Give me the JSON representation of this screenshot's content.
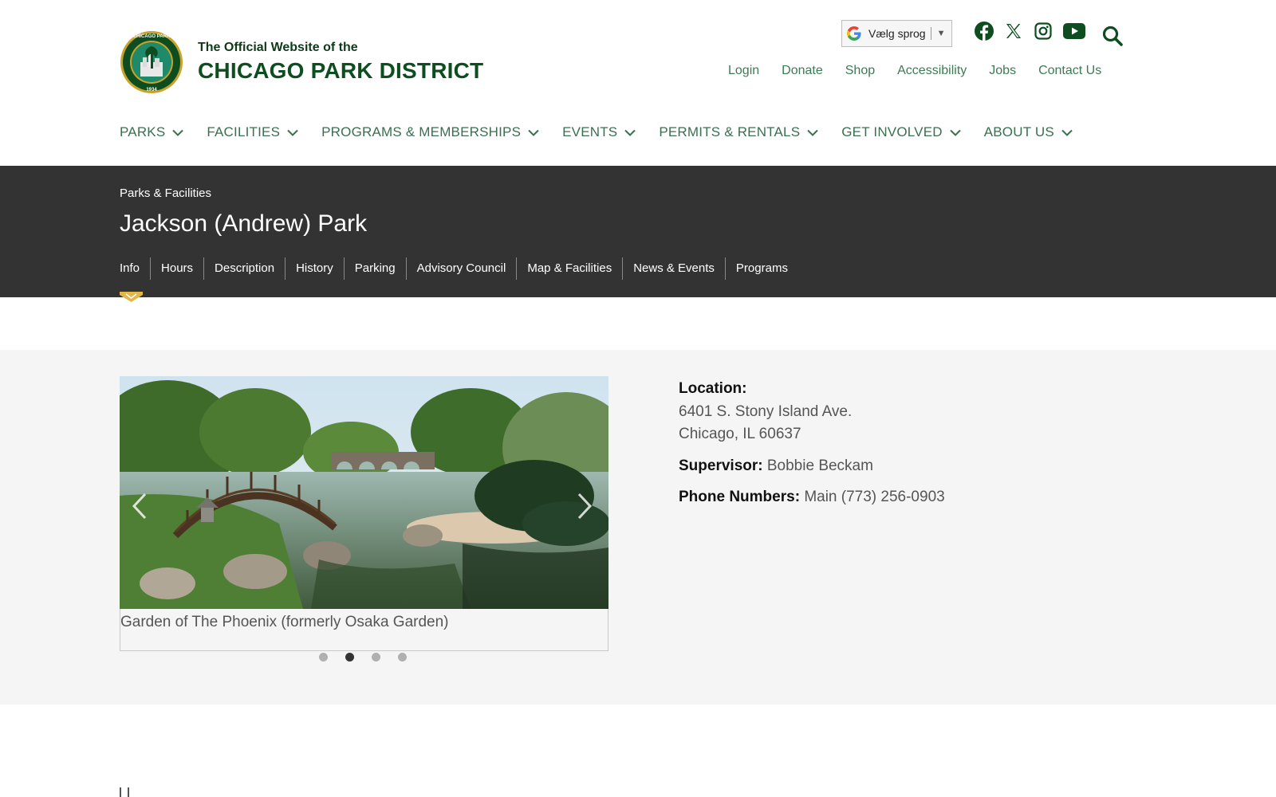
{
  "header": {
    "logo_sub": "The Official Website of the",
    "logo_main": "CHICAGO PARK DISTRICT",
    "seal_text": "CHICAGO PARK DISTRICT SEAL · ORGANIZED 1934 ·",
    "translate_label": "Vælg sprog",
    "translate_arrow": "▼",
    "social": [
      "facebook-icon",
      "x-twitter-icon",
      "instagram-icon",
      "youtube-icon",
      "search-icon"
    ],
    "brand_color": "#0d4d1f",
    "utility_links": [
      "Login",
      "Donate",
      "Shop",
      "Accessibility",
      "Jobs",
      "Contact Us"
    ],
    "main_nav": [
      "PARKS",
      "FACILITIES",
      "PROGRAMS & MEMBERSHIPS",
      "EVENTS",
      "PERMITS & RENTALS",
      "GET INVOLVED",
      "ABOUT US"
    ]
  },
  "banner": {
    "breadcrumb": "Parks & Facilities",
    "title": "Jackson (Andrew) Park",
    "tabs": [
      "Info",
      "Hours",
      "Description",
      "History",
      "Parking",
      "Advisory Council",
      "Map & Facilities",
      "News & Events",
      "Programs"
    ],
    "active_tab": "Info",
    "indicator_color": "#e0b84a",
    "background": "#333333"
  },
  "carousel": {
    "caption": "Garden of The Phoenix (formerly Osaka Garden)",
    "slide_count": 4,
    "active_slide": 2,
    "prev_icon": "chevron-left-icon",
    "next_icon": "chevron-right-icon"
  },
  "info": {
    "location_label": "Location:",
    "address_line1": "6401 S. Stony Island Ave.",
    "address_line2": "Chicago, IL 60637",
    "supervisor_label": "Supervisor:",
    "supervisor_name": "Bobbie Beckam",
    "phone_label": "Phone Numbers:",
    "phone_value": "Main (773) 256-0903"
  }
}
